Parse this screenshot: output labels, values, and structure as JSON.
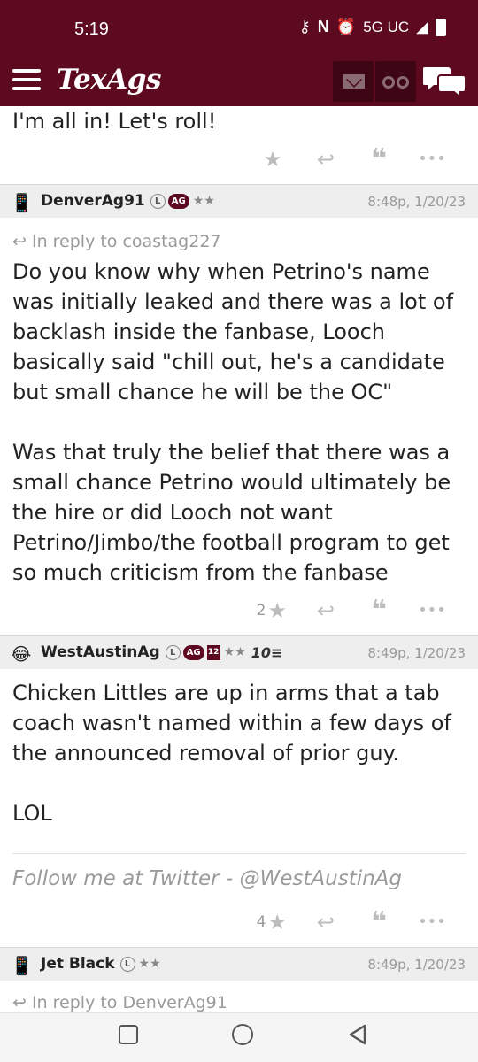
{
  "status_bar": {
    "time": "5:19",
    "network": "5G UC"
  },
  "app": {
    "logo": "TexAgs"
  },
  "posts": [
    {
      "text": "I'm all in! Let's roll!",
      "stars": ""
    },
    {
      "username": "DenverAg91",
      "badge_l": "L",
      "badge_ag": "AG",
      "rank": "★★",
      "timestamp": "8:48p, 1/20/23",
      "reply_to": "In reply to coastag227",
      "paragraphs": [
        "Do you know why when Petrino's name was initially leaked and there was a lot of backlash inside the fanbase, Looch basically said \"chill out, he's a candidate but small chance he will be the OC\"",
        "Was that truly the belief that there was a small chance Petrino would ultimately be the hire or did Looch not want Petrino/Jimbo/the football program to get so much criticism from the fanbase"
      ],
      "stars": "2"
    },
    {
      "username": "WestAustinAg",
      "badge_l": "L",
      "badge_ag": "AG",
      "badge_12": "12",
      "rank": "★★",
      "extra": "10≡",
      "timestamp": "8:49p, 1/20/23",
      "paragraphs": [
        "Chicken Littles are up in arms that a tab coach wasn't named within a few days of the announced removal of prior guy.",
        "LOL"
      ],
      "signature": "Follow me at Twitter - @WestAustinAg",
      "stars": "4"
    },
    {
      "username": "Jet Black",
      "badge_l": "L",
      "rank": "★★",
      "timestamp": "8:49p, 1/20/23",
      "reply_to": "In reply to DenverAg91"
    }
  ],
  "icons": {
    "star": "★",
    "reply": "↩",
    "quote": "❝",
    "more": "•••"
  },
  "colors": {
    "brand": "#5d0a20",
    "muted": "#9a9a9a"
  }
}
